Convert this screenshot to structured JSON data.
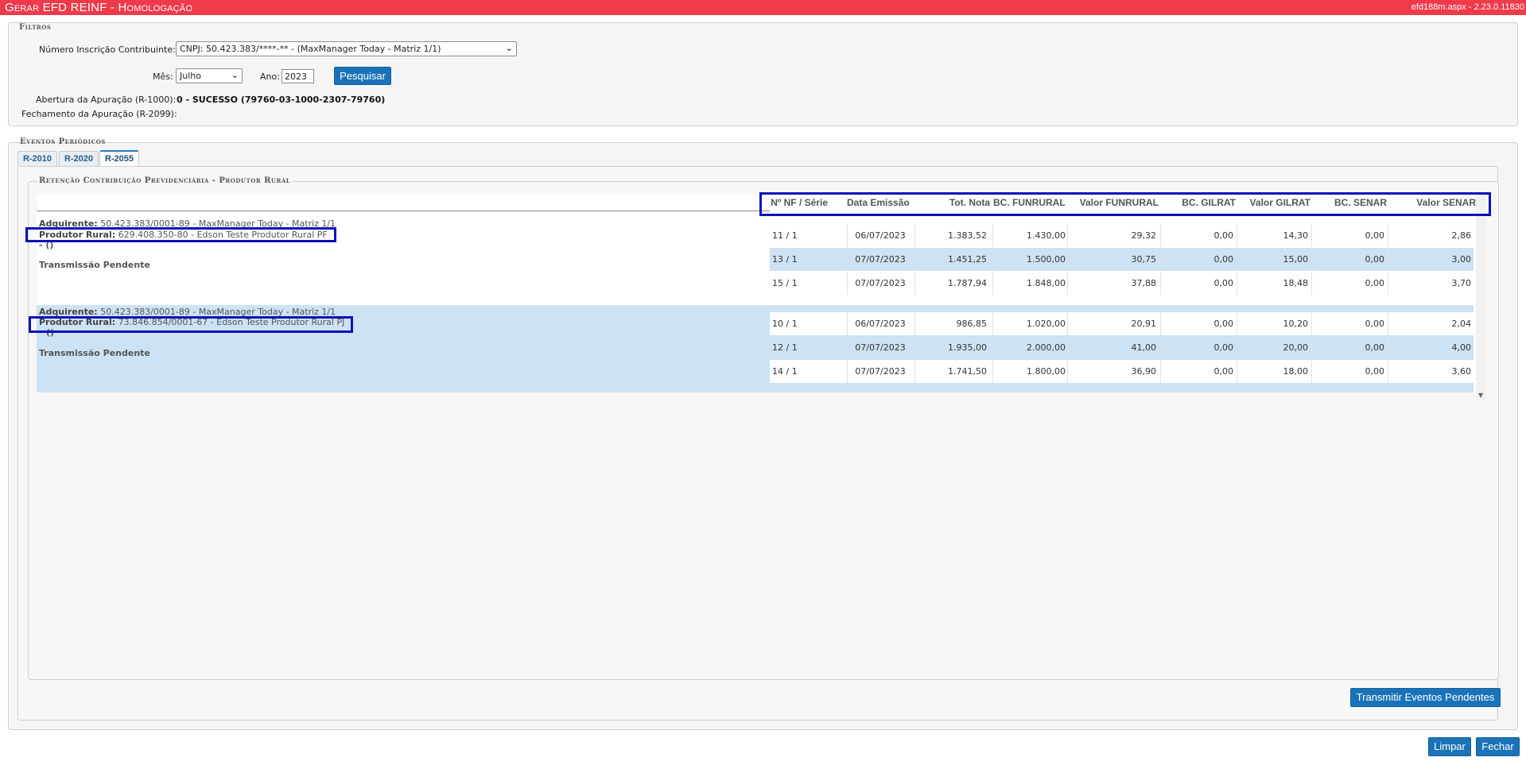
{
  "app": {
    "title": "Gerar EFD REINF  - Homologação",
    "version": "efd188m.aspx - 2.23.0.11830"
  },
  "filters": {
    "legend": "Filtros",
    "contribuinte_label": "Número Inscrição Contribuinte:",
    "contribuinte_value": "CNPJ: 50.423.383/****-** - (MaxManager Today - Matriz 1/1)",
    "mes_label": "Mês:",
    "mes_value": "Julho",
    "ano_label": "Ano:",
    "ano_value": "2023",
    "search_button": "Pesquisar",
    "abertura_label": "Abertura da Apuração (R-1000):",
    "abertura_value": "0 - SUCESSO (79760-03-1000-2307-79760)",
    "fechamento_label": "Fechamento da Apuração (R-2099):",
    "fechamento_value": ""
  },
  "eventos": {
    "legend": "Eventos Periódicos",
    "tabs": [
      {
        "label": "R-2010",
        "active": false
      },
      {
        "label": "R-2020",
        "active": false
      },
      {
        "label": "R-2055",
        "active": true
      }
    ],
    "section_legend": "Retenção Contribuição Previdenciária - Produtor Rural",
    "columns": [
      "Nº NF / Série",
      "Data Emissão",
      "Tot. Nota",
      "BC. FUNRURAL",
      "Valor FUNRURAL",
      "BC. GILRAT",
      "Valor GILRAT",
      "BC. SENAR",
      "Valor SENAR"
    ],
    "groups": [
      {
        "adquirente_label": "Adquirente:",
        "adquirente_value": "50.423.383/0001-89 - MaxManager Today - Matriz 1/1",
        "produtor_label": "Produtor Rural:",
        "produtor_value": "629.408.350-80 - Edson Teste Produtor Rural PF",
        "extra": "- ()",
        "status": "Transmissão Pendente",
        "rows": [
          [
            "11 / 1",
            "06/07/2023",
            "1.383,52",
            "1.430,00",
            "29,32",
            "0,00",
            "14,30",
            "0,00",
            "2,86"
          ],
          [
            "13 / 1",
            "07/07/2023",
            "1.451,25",
            "1.500,00",
            "30,75",
            "0,00",
            "15,00",
            "0,00",
            "3,00"
          ],
          [
            "15 / 1",
            "07/07/2023",
            "1.787,94",
            "1.848,00",
            "37,88",
            "0,00",
            "18,48",
            "0,00",
            "3,70"
          ]
        ]
      },
      {
        "adquirente_label": "Adquirente:",
        "adquirente_value": "50.423.383/0001-89 - MaxManager Today - Matriz 1/1",
        "produtor_label": "Produtor Rural:",
        "produtor_value": "73.846.854/0001-67 - Edson Teste Produtor Rural PJ",
        "extra": "()",
        "status": "Transmissão Pendente",
        "rows": [
          [
            "10 / 1",
            "06/07/2023",
            "986,85",
            "1.020,00",
            "20,91",
            "0,00",
            "10,20",
            "0,00",
            "2,04"
          ],
          [
            "12 / 1",
            "07/07/2023",
            "1.935,00",
            "2.000,00",
            "41,00",
            "0,00",
            "20,00",
            "0,00",
            "4,00"
          ],
          [
            "14 / 1",
            "07/07/2023",
            "1.741,50",
            "1.800,00",
            "36,90",
            "0,00",
            "18,00",
            "0,00",
            "3,60"
          ]
        ]
      }
    ],
    "transmit_button": "Transmitir Eventos Pendentes"
  },
  "footer": {
    "clear_button": "Limpar",
    "close_button": "Fechar"
  },
  "colors": {
    "title_bar": "#ef3a4a",
    "button": "#1a73b8",
    "row_highlight": "#cde2f2",
    "annotation_box": "#1010b8"
  }
}
